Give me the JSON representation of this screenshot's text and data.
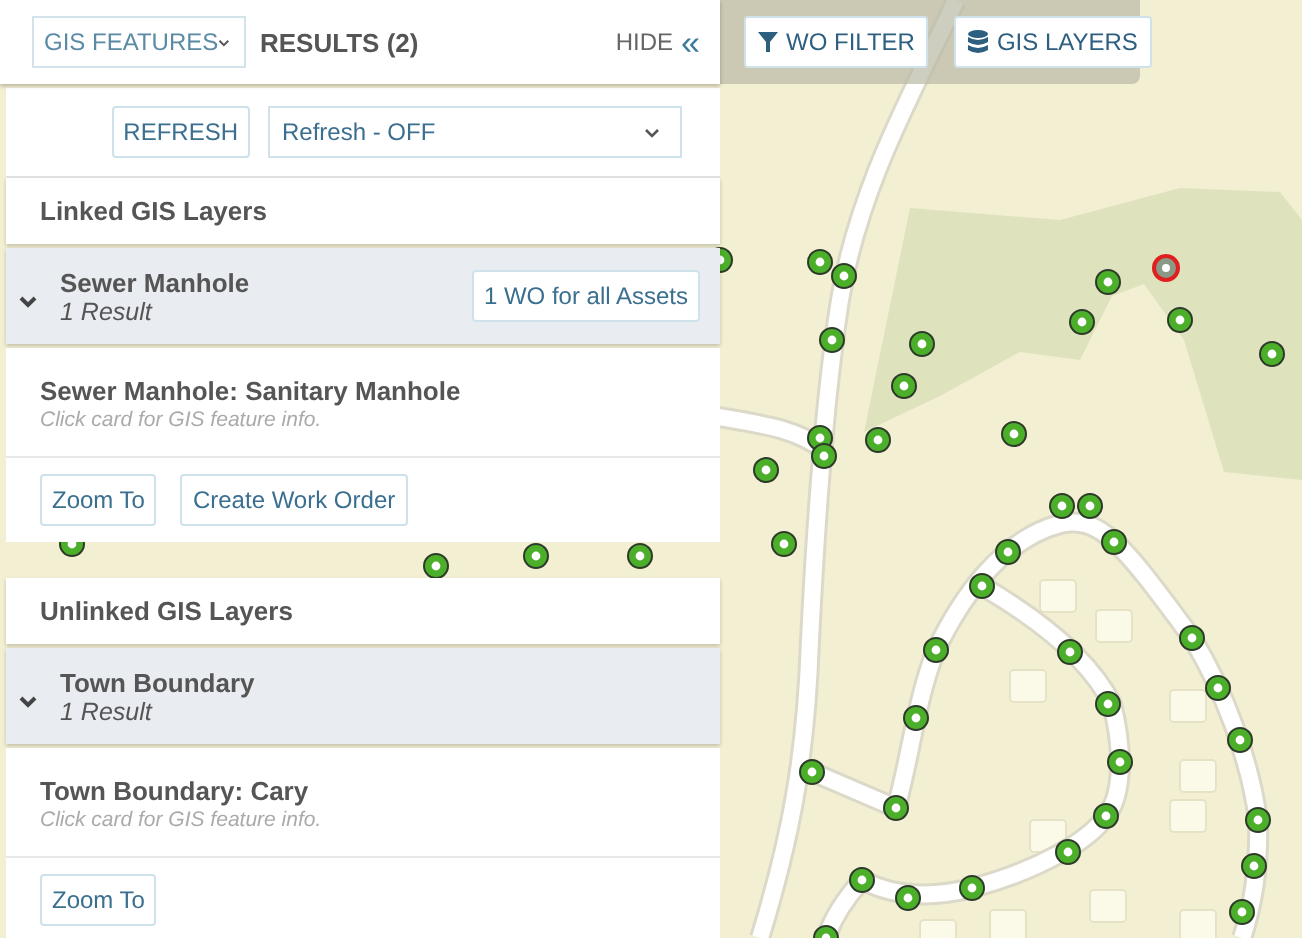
{
  "panel": {
    "mode_dropdown": {
      "value": "GIS FEATURES"
    },
    "results_title": "RESULTS (2)",
    "hide_button": {
      "label": "HIDE",
      "icon": "«"
    },
    "refresh_button": "REFRESH",
    "refresh_dropdown": {
      "value": "Refresh - OFF"
    },
    "sections": [
      {
        "heading": "Linked GIS Layers",
        "groups": [
          {
            "name": "Sewer Manhole",
            "count": "1 Result",
            "expanded": true,
            "action": "1 WO for all Assets",
            "cards": [
              {
                "title": "Sewer Manhole: Sanitary Manhole",
                "hint": "Click card for GIS feature info.",
                "buttons": [
                  "Zoom To",
                  "Create Work Order"
                ]
              }
            ]
          }
        ]
      },
      {
        "heading": "Unlinked GIS Layers",
        "groups": [
          {
            "name": "Town Boundary",
            "count": "1 Result",
            "expanded": true,
            "cards": [
              {
                "title": "Town Boundary: Cary",
                "hint": "Click card for GIS feature info.",
                "buttons": [
                  "Zoom To"
                ]
              }
            ]
          }
        ]
      }
    ]
  },
  "map_toolbar": {
    "buttons": [
      {
        "label": "WO FILTER",
        "kind": "filter"
      },
      {
        "label": "GIS LAYERS",
        "kind": "layers"
      }
    ]
  }
}
